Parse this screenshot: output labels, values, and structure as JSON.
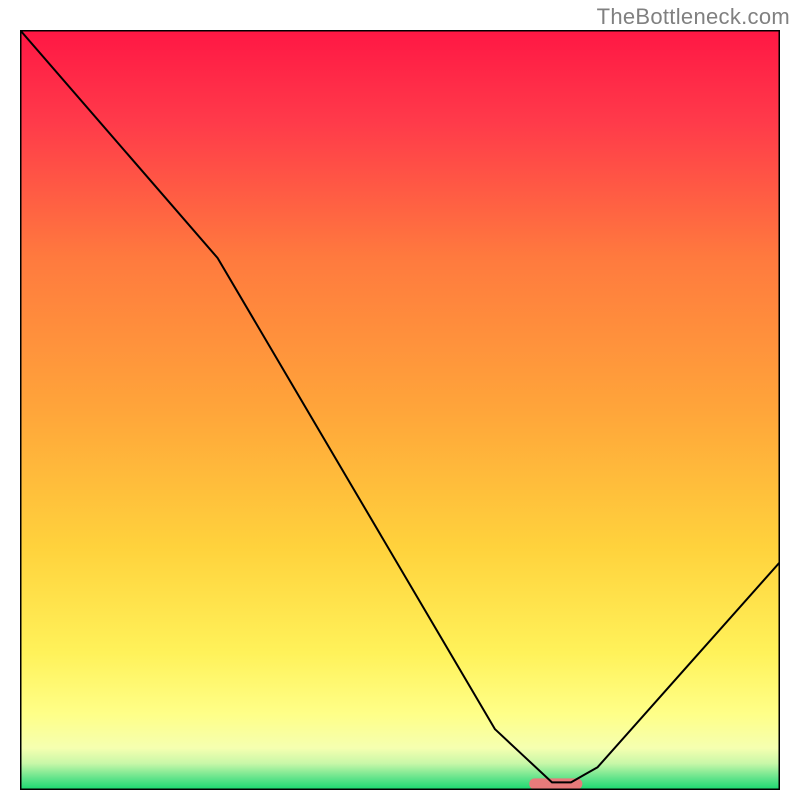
{
  "attribution": "TheBottleneck.com",
  "chart_data": {
    "type": "line",
    "title": "",
    "xlabel": "",
    "ylabel": "",
    "xlim": [
      0,
      100
    ],
    "ylim": [
      0,
      100
    ],
    "series": [
      {
        "name": "bottleneck-curve",
        "x": [
          0,
          26,
          62.5,
          70,
          72.5,
          76,
          100
        ],
        "values": [
          100,
          70,
          8,
          1,
          1,
          3,
          30
        ]
      }
    ],
    "marker": {
      "name": "optimal-zone",
      "x_start": 67,
      "x_end": 74,
      "y": 0.8,
      "color": "#e77b7b"
    },
    "background": {
      "type": "vertical-gradient",
      "stops": [
        {
          "pos": 0.0,
          "color": "#ff1744"
        },
        {
          "pos": 0.12,
          "color": "#ff3a4a"
        },
        {
          "pos": 0.3,
          "color": "#ff7a3e"
        },
        {
          "pos": 0.5,
          "color": "#ffa53a"
        },
        {
          "pos": 0.68,
          "color": "#ffd23c"
        },
        {
          "pos": 0.82,
          "color": "#fff25a"
        },
        {
          "pos": 0.9,
          "color": "#ffff88"
        },
        {
          "pos": 0.945,
          "color": "#f5ffb0"
        },
        {
          "pos": 0.965,
          "color": "#c8f7a8"
        },
        {
          "pos": 0.985,
          "color": "#5fe38a"
        },
        {
          "pos": 1.0,
          "color": "#17d86e"
        }
      ]
    },
    "curve_stroke": "#000000",
    "curve_stroke_width": 2,
    "frame_stroke": "#000000",
    "frame_stroke_width": 3
  }
}
